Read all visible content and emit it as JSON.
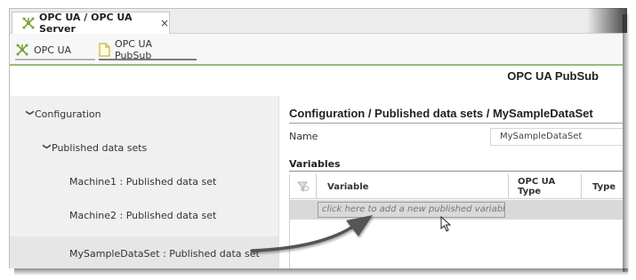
{
  "window_tab": {
    "title": "OPC UA / OPC UA Server",
    "close_glyph": "×"
  },
  "sub_tabs": [
    {
      "label": "OPC UA",
      "icon": "opc-ua-network-icon"
    },
    {
      "label": "OPC UA PubSub",
      "icon": "document-icon"
    }
  ],
  "page_title": "OPC UA PubSub",
  "tree": {
    "items": [
      {
        "label": "Configuration",
        "expanded": true
      },
      {
        "label": "Published data sets",
        "expanded": true
      },
      {
        "label": "Machine1 : Published data set"
      },
      {
        "label": "Machine2 : Published data set"
      },
      {
        "label": "MySampleDataSet : Published data set",
        "selected": true
      }
    ]
  },
  "detail": {
    "breadcrumb": "Configuration / Published data sets / MySampleDataSet",
    "name_label": "Name",
    "name_value": "MySampleDataSet",
    "variables_label": "Variables",
    "columns": [
      "Variable",
      "OPC UA Type",
      "Type"
    ],
    "add_placeholder": "click here to add a new published variable"
  },
  "colors": {
    "accent_green": "#7aa33a",
    "tab_underline": "#9ab87b"
  }
}
